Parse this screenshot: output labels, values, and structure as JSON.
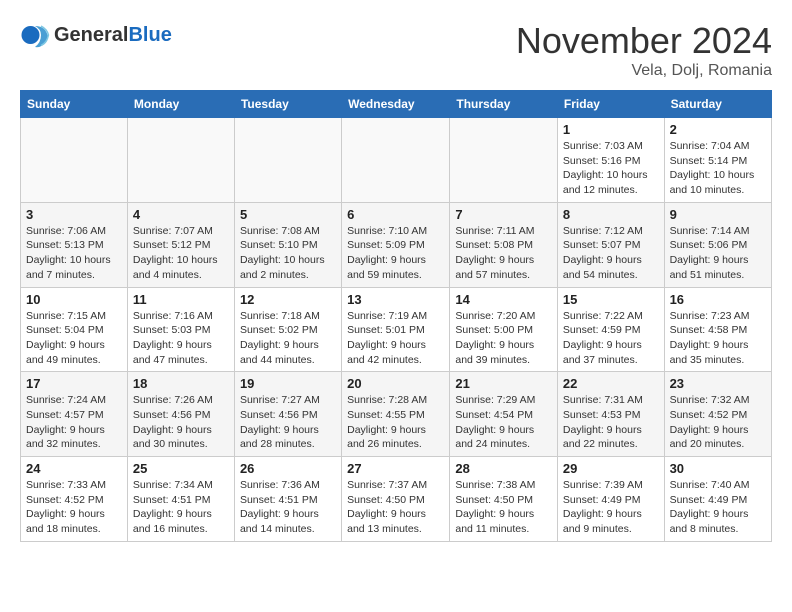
{
  "header": {
    "logo_line1": "General",
    "logo_line2": "Blue",
    "month": "November 2024",
    "location": "Vela, Dolj, Romania"
  },
  "weekdays": [
    "Sunday",
    "Monday",
    "Tuesday",
    "Wednesday",
    "Thursday",
    "Friday",
    "Saturday"
  ],
  "weeks": [
    [
      {
        "day": "",
        "info": ""
      },
      {
        "day": "",
        "info": ""
      },
      {
        "day": "",
        "info": ""
      },
      {
        "day": "",
        "info": ""
      },
      {
        "day": "",
        "info": ""
      },
      {
        "day": "1",
        "info": "Sunrise: 7:03 AM\nSunset: 5:16 PM\nDaylight: 10 hours\nand 12 minutes."
      },
      {
        "day": "2",
        "info": "Sunrise: 7:04 AM\nSunset: 5:14 PM\nDaylight: 10 hours\nand 10 minutes."
      }
    ],
    [
      {
        "day": "3",
        "info": "Sunrise: 7:06 AM\nSunset: 5:13 PM\nDaylight: 10 hours\nand 7 minutes."
      },
      {
        "day": "4",
        "info": "Sunrise: 7:07 AM\nSunset: 5:12 PM\nDaylight: 10 hours\nand 4 minutes."
      },
      {
        "day": "5",
        "info": "Sunrise: 7:08 AM\nSunset: 5:10 PM\nDaylight: 10 hours\nand 2 minutes."
      },
      {
        "day": "6",
        "info": "Sunrise: 7:10 AM\nSunset: 5:09 PM\nDaylight: 9 hours\nand 59 minutes."
      },
      {
        "day": "7",
        "info": "Sunrise: 7:11 AM\nSunset: 5:08 PM\nDaylight: 9 hours\nand 57 minutes."
      },
      {
        "day": "8",
        "info": "Sunrise: 7:12 AM\nSunset: 5:07 PM\nDaylight: 9 hours\nand 54 minutes."
      },
      {
        "day": "9",
        "info": "Sunrise: 7:14 AM\nSunset: 5:06 PM\nDaylight: 9 hours\nand 51 minutes."
      }
    ],
    [
      {
        "day": "10",
        "info": "Sunrise: 7:15 AM\nSunset: 5:04 PM\nDaylight: 9 hours\nand 49 minutes."
      },
      {
        "day": "11",
        "info": "Sunrise: 7:16 AM\nSunset: 5:03 PM\nDaylight: 9 hours\nand 47 minutes."
      },
      {
        "day": "12",
        "info": "Sunrise: 7:18 AM\nSunset: 5:02 PM\nDaylight: 9 hours\nand 44 minutes."
      },
      {
        "day": "13",
        "info": "Sunrise: 7:19 AM\nSunset: 5:01 PM\nDaylight: 9 hours\nand 42 minutes."
      },
      {
        "day": "14",
        "info": "Sunrise: 7:20 AM\nSunset: 5:00 PM\nDaylight: 9 hours\nand 39 minutes."
      },
      {
        "day": "15",
        "info": "Sunrise: 7:22 AM\nSunset: 4:59 PM\nDaylight: 9 hours\nand 37 minutes."
      },
      {
        "day": "16",
        "info": "Sunrise: 7:23 AM\nSunset: 4:58 PM\nDaylight: 9 hours\nand 35 minutes."
      }
    ],
    [
      {
        "day": "17",
        "info": "Sunrise: 7:24 AM\nSunset: 4:57 PM\nDaylight: 9 hours\nand 32 minutes."
      },
      {
        "day": "18",
        "info": "Sunrise: 7:26 AM\nSunset: 4:56 PM\nDaylight: 9 hours\nand 30 minutes."
      },
      {
        "day": "19",
        "info": "Sunrise: 7:27 AM\nSunset: 4:56 PM\nDaylight: 9 hours\nand 28 minutes."
      },
      {
        "day": "20",
        "info": "Sunrise: 7:28 AM\nSunset: 4:55 PM\nDaylight: 9 hours\nand 26 minutes."
      },
      {
        "day": "21",
        "info": "Sunrise: 7:29 AM\nSunset: 4:54 PM\nDaylight: 9 hours\nand 24 minutes."
      },
      {
        "day": "22",
        "info": "Sunrise: 7:31 AM\nSunset: 4:53 PM\nDaylight: 9 hours\nand 22 minutes."
      },
      {
        "day": "23",
        "info": "Sunrise: 7:32 AM\nSunset: 4:52 PM\nDaylight: 9 hours\nand 20 minutes."
      }
    ],
    [
      {
        "day": "24",
        "info": "Sunrise: 7:33 AM\nSunset: 4:52 PM\nDaylight: 9 hours\nand 18 minutes."
      },
      {
        "day": "25",
        "info": "Sunrise: 7:34 AM\nSunset: 4:51 PM\nDaylight: 9 hours\nand 16 minutes."
      },
      {
        "day": "26",
        "info": "Sunrise: 7:36 AM\nSunset: 4:51 PM\nDaylight: 9 hours\nand 14 minutes."
      },
      {
        "day": "27",
        "info": "Sunrise: 7:37 AM\nSunset: 4:50 PM\nDaylight: 9 hours\nand 13 minutes."
      },
      {
        "day": "28",
        "info": "Sunrise: 7:38 AM\nSunset: 4:50 PM\nDaylight: 9 hours\nand 11 minutes."
      },
      {
        "day": "29",
        "info": "Sunrise: 7:39 AM\nSunset: 4:49 PM\nDaylight: 9 hours\nand 9 minutes."
      },
      {
        "day": "30",
        "info": "Sunrise: 7:40 AM\nSunset: 4:49 PM\nDaylight: 9 hours\nand 8 minutes."
      }
    ]
  ]
}
